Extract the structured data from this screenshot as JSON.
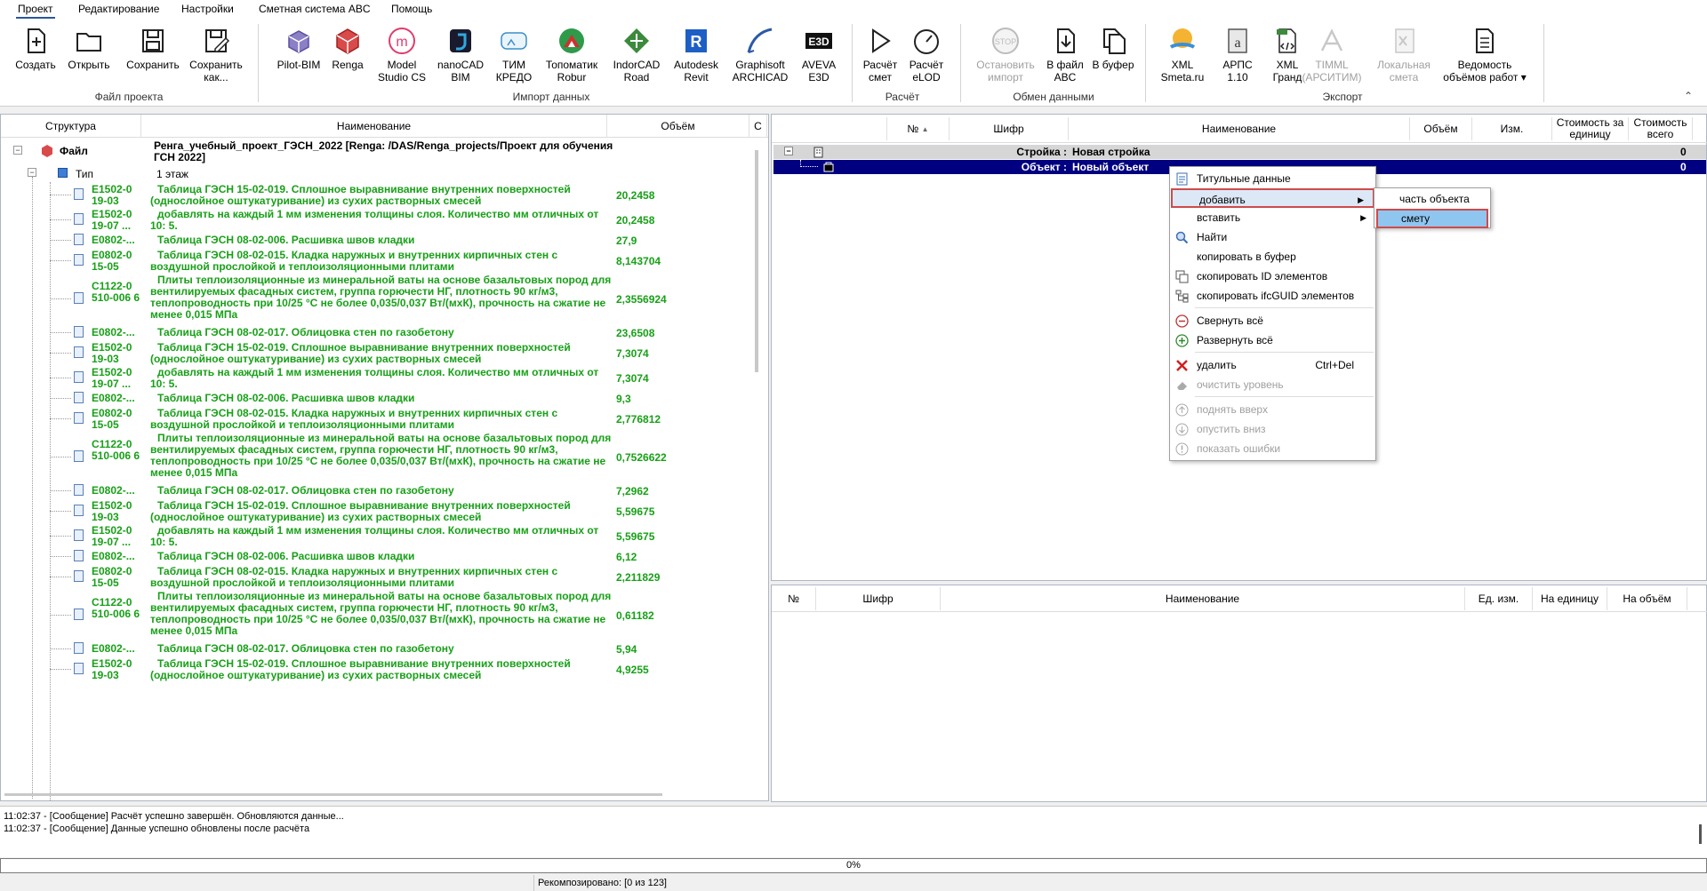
{
  "menu": {
    "tabs": [
      "Проект",
      "Редактирование",
      "Настройки",
      "Сметная система ABC",
      "Помощь"
    ],
    "active": "Проект"
  },
  "ribbon": {
    "buttons": {
      "create": "Создать",
      "open": "Открыть",
      "save": "Сохранить",
      "save_as": "Сохранить как...",
      "pilot": "Pilot-BIM",
      "renga": "Renga",
      "model_studio": "Model Studio CS",
      "nanocad": "nanoCAD BIM",
      "tim_kredo": "ТИМ КРЕДО",
      "topomatik": "Топоматик Robur",
      "indorcad": "IndorCAD Road",
      "revit": "Autodesk Revit",
      "archicad": "Graphisoft ARCHICAD",
      "aveva": "AVEVA E3D",
      "calc_smet": "Расчёт смет",
      "calc_elod": "Расчёт eLOD",
      "stop_import": "Остановить импорт",
      "to_abc": "В файл ABC",
      "to_buffer": "В буфер",
      "xml_smeta": "XML Smeta.ru",
      "arps": "АРПС 1.10",
      "xml_grand": "XML Гранд",
      "timml": "TIMML (АРСИТИМ)",
      "local_smeta": "Локальная смета",
      "vedomost": "Ведомость объёмов работ"
    },
    "groups": {
      "file": "Файл проекта",
      "import": "Импорт данных",
      "calc": "Расчёт",
      "exchange": "Обмен данными",
      "export": "Экспорт"
    }
  },
  "left_tree": {
    "headers": [
      "Структура",
      "Наименование",
      "Объём",
      "С"
    ],
    "root_label": "Файл",
    "root_name": "Ренга_учебный_проект_ГЭСН_2022 [Renga: /DAS/Renga_projects/Проект для обучения ГСН 2022]",
    "type_label": "Тип",
    "type_value": "1 этаж",
    "rows": [
      {
        "code": "E1502-0 19-03",
        "desc": "Таблица ГЭСН 15-02-019. Сплошное выравнивание внутренних поверхностей (однослойное оштукатуривание) из сухих растворных смесей",
        "vol": "20,2458"
      },
      {
        "code": "E1502-0 19-07 ...",
        "desc": "добавлять на каждый 1 мм изменения толщины слоя. Количество мм отличных от 10: 5.",
        "vol": "20,2458"
      },
      {
        "code": "E0802-...",
        "desc": "Таблица ГЭСН 08-02-006. Расшивка швов кладки",
        "vol": "27,9"
      },
      {
        "code": "E0802-0 15-05",
        "desc": "Таблица ГЭСН 08-02-015. Кладка наружных и внутренних кирпичных стен с воздушной прослойкой и теплоизоляционными плитами",
        "vol": "8,143704"
      },
      {
        "code": "C1122-0 510-006 6",
        "desc": "Плиты теплоизоляционные из минеральной ваты на основе базальтовых пород для вентилируемых фасадных систем, группа горючести НГ, плотность 90 кг/м3, теплопроводность при 10/25 °С не более 0,035/0,037 Вт/(мхК), прочность на сжатие не менее 0,015 МПа",
        "vol": "2,3556924"
      },
      {
        "code": "E0802-...",
        "desc": "Таблица ГЭСН 08-02-017. Облицовка стен по газобетону",
        "vol": "23,6508"
      },
      {
        "code": "E1502-0 19-03",
        "desc": "Таблица ГЭСН 15-02-019. Сплошное выравнивание внутренних поверхностей (однослойное оштукатуривание) из сухих растворных смесей",
        "vol": "7,3074"
      },
      {
        "code": "E1502-0 19-07 ...",
        "desc": "добавлять на каждый 1 мм изменения толщины слоя. Количество мм отличных от 10: 5.",
        "vol": "7,3074"
      },
      {
        "code": "E0802-...",
        "desc": "Таблица ГЭСН 08-02-006. Расшивка швов кладки",
        "vol": "9,3"
      },
      {
        "code": "E0802-0 15-05",
        "desc": "Таблица ГЭСН 08-02-015. Кладка наружных и внутренних кирпичных стен с воздушной прослойкой и теплоизоляционными плитами",
        "vol": "2,776812"
      },
      {
        "code": "C1122-0 510-006 6",
        "desc": "Плиты теплоизоляционные из минеральной ваты на основе базальтовых пород для вентилируемых фасадных систем, группа горючести НГ, плотность 90 кг/м3, теплопроводность при 10/25 °С не более 0,035/0,037 Вт/(мхК), прочность на сжатие не менее 0,015 МПа",
        "vol": "0,7526622"
      },
      {
        "code": "E0802-...",
        "desc": "Таблица ГЭСН 08-02-017. Облицовка стен по газобетону",
        "vol": "7,2962"
      },
      {
        "code": "E1502-0 19-03",
        "desc": "Таблица ГЭСН 15-02-019. Сплошное выравнивание внутренних поверхностей (однослойное оштукатуривание) из сухих растворных смесей",
        "vol": "5,59675"
      },
      {
        "code": "E1502-0 19-07 ...",
        "desc": "добавлять на каждый 1 мм изменения толщины слоя. Количество мм отличных от 10: 5.",
        "vol": "5,59675"
      },
      {
        "code": "E0802-...",
        "desc": "Таблица ГЭСН 08-02-006. Расшивка швов кладки",
        "vol": "6,12"
      },
      {
        "code": "E0802-0 15-05",
        "desc": "Таблица ГЭСН 08-02-015. Кладка наружных и внутренних кирпичных стен с воздушной прослойкой и теплоизоляционными плитами",
        "vol": "2,211829"
      },
      {
        "code": "C1122-0 510-006 6",
        "desc": "Плиты теплоизоляционные из минеральной ваты на основе базальтовых пород для вентилируемых фасадных систем, группа горючести НГ, плотность 90 кг/м3, теплопроводность при 10/25 °С не более 0,035/0,037 Вт/(мхК), прочность на сжатие не менее 0,015 МПа",
        "vol": "0,61182"
      },
      {
        "code": "E0802-...",
        "desc": "Таблица ГЭСН 08-02-017. Облицовка стен по газобетону",
        "vol": "5,94"
      },
      {
        "code": "E1502-0 19-03",
        "desc": "Таблица ГЭСН 15-02-019. Сплошное выравнивание внутренних поверхностей (однослойное оштукатуривание) из сухих растворных смесей",
        "vol": "4,9255"
      }
    ]
  },
  "right_top": {
    "headers": [
      "№",
      "Шифр",
      "Наименование",
      "Объём",
      "Изм.",
      "Стоимость за единицу",
      "Стоимость всего"
    ],
    "rows": [
      {
        "label": "Стройка :",
        "name": "Новая стройка",
        "total": "0"
      },
      {
        "label": "Объект :",
        "name": "Новый объект",
        "total": "0"
      }
    ]
  },
  "right_bottom": {
    "headers": [
      "№",
      "Шифр",
      "Наименование",
      "Ед. изм.",
      "На единицу",
      "На объём"
    ]
  },
  "context_menu": {
    "items": [
      {
        "label": "Титульные данные"
      },
      {
        "label": "добавить"
      },
      {
        "label": "вставить"
      },
      {
        "label": "Найти"
      },
      {
        "label": "копировать в буфер"
      },
      {
        "label": "скопировать ID элементов"
      },
      {
        "label": "скопировать ifcGUID элементов"
      },
      {
        "label": "Свернуть всё"
      },
      {
        "label": "Развернуть всё"
      },
      {
        "label": "удалить",
        "shortcut": "Ctrl+Del"
      },
      {
        "label": "очистить уровень"
      },
      {
        "label": "поднять вверх"
      },
      {
        "label": "опустить вниз"
      },
      {
        "label": "показать ошибки"
      }
    ]
  },
  "submenu": {
    "items": [
      {
        "label": "часть объекта"
      },
      {
        "label": "смету"
      }
    ]
  },
  "log": {
    "lines": [
      "11:02:37 - [Сообщение] Расчёт успешно завершён. Обновляются данные...",
      "11:02:37 - [Сообщение] Данные успешно обновлены после расчёта"
    ]
  },
  "progress": "0%",
  "status": "Рекомпозировано: [0 из 123]",
  "colors": {
    "accent": "#2b579a",
    "green_text": "#18a018",
    "selected_row": "#000080",
    "highlight_border": "#d04a4a"
  }
}
